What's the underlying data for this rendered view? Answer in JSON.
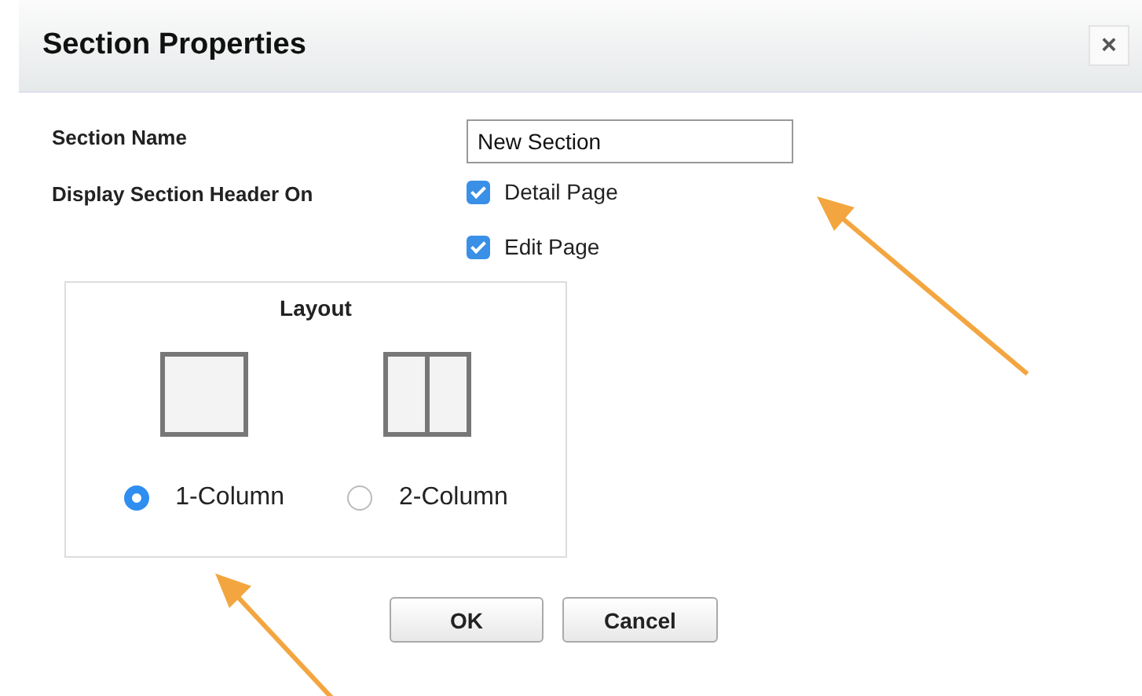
{
  "dialog": {
    "title": "Section Properties",
    "close": "×"
  },
  "section_name": {
    "label": "Section Name",
    "value": "New Section"
  },
  "display_header": {
    "label": "Display Section Header On",
    "options": [
      {
        "label": "Detail Page",
        "checked": true
      },
      {
        "label": "Edit Page",
        "checked": true
      }
    ]
  },
  "layout": {
    "title": "Layout",
    "options": [
      {
        "label": "1-Column",
        "kind": "one",
        "selected": true
      },
      {
        "label": "2-Column",
        "kind": "two",
        "selected": false
      }
    ]
  },
  "buttons": [
    "OK",
    "Cancel"
  ]
}
